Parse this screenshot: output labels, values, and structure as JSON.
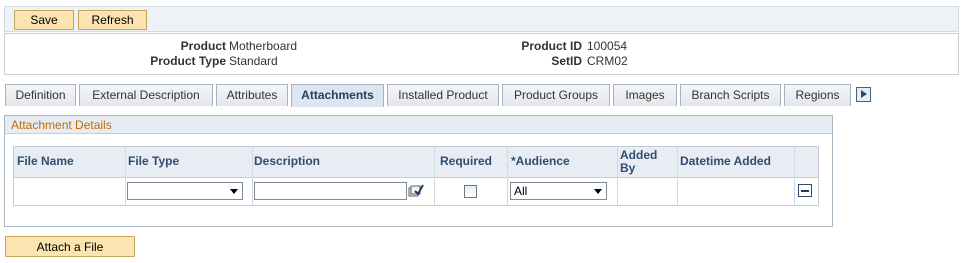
{
  "toolbar": {
    "save_label": "Save",
    "refresh_label": "Refresh"
  },
  "header": {
    "product_label": "Product",
    "product_value": "Motherboard",
    "product_type_label": "Product Type",
    "product_type_value": "Standard",
    "product_id_label": "Product ID",
    "product_id_value": "100054",
    "setid_label": "SetID",
    "setid_value": "CRM02"
  },
  "tabs": [
    {
      "label": "Definition"
    },
    {
      "label": "External Description"
    },
    {
      "label": "Attributes"
    },
    {
      "label": "Attachments",
      "active": true
    },
    {
      "label": "Installed Product"
    },
    {
      "label": "Product Groups"
    },
    {
      "label": "Images"
    },
    {
      "label": "Branch Scripts"
    },
    {
      "label": "Regions"
    }
  ],
  "attachments": {
    "title": "Attachment Details",
    "columns": {
      "file_name": "File Name",
      "file_type": "File Type",
      "description": "Description",
      "required": "Required",
      "audience": "*Audience",
      "added_by_1": "Added",
      "added_by_2": "By",
      "datetime_added": "Datetime Added"
    },
    "row": {
      "file_name": "",
      "file_type": "",
      "description": "",
      "required": false,
      "audience": "All",
      "added_by": "",
      "datetime_added": ""
    }
  },
  "footer": {
    "attach_label": "Attach a File"
  },
  "icons": {
    "prompt": "prompt-lookup-icon",
    "delete_row": "delete-row-icon",
    "tab_scroll": "tab-scroll-right-icon"
  }
}
